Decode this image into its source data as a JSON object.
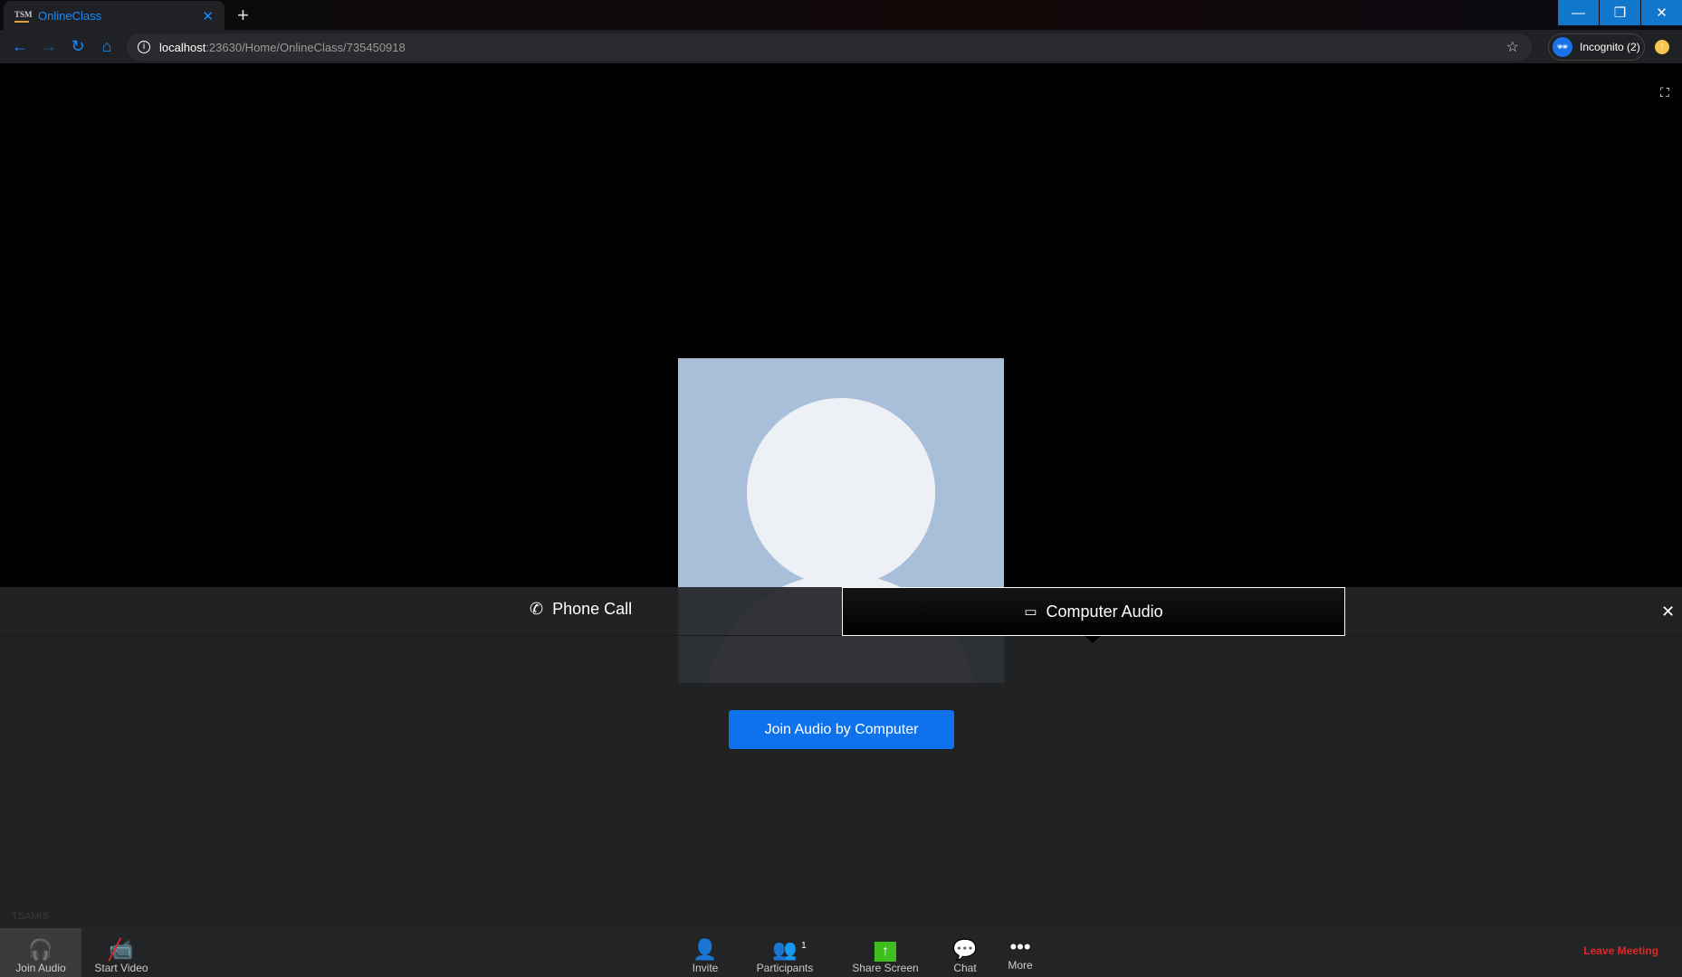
{
  "browser": {
    "tab_title": "OnlineClass",
    "url_host": "localhost",
    "url_path": ":23630/Home/OnlineClass/735450918",
    "profile": "Incognito (2)"
  },
  "audio_panel": {
    "tabs": [
      {
        "label": "Phone Call"
      },
      {
        "label": "Computer Audio",
        "active": true
      }
    ],
    "join_button": "Join Audio by Computer"
  },
  "watermark": "TSAMIS",
  "toolbar": {
    "join_audio": "Join Audio",
    "start_video": "Start Video",
    "invite": "Invite",
    "participants": "Participants",
    "participants_count": "1",
    "share_screen": "Share Screen",
    "chat": "Chat",
    "more": "More",
    "leave": "Leave Meeting"
  },
  "colors": {
    "accent": "#0e72ed",
    "leave": "#e02828",
    "share": "#3fbf1f"
  }
}
